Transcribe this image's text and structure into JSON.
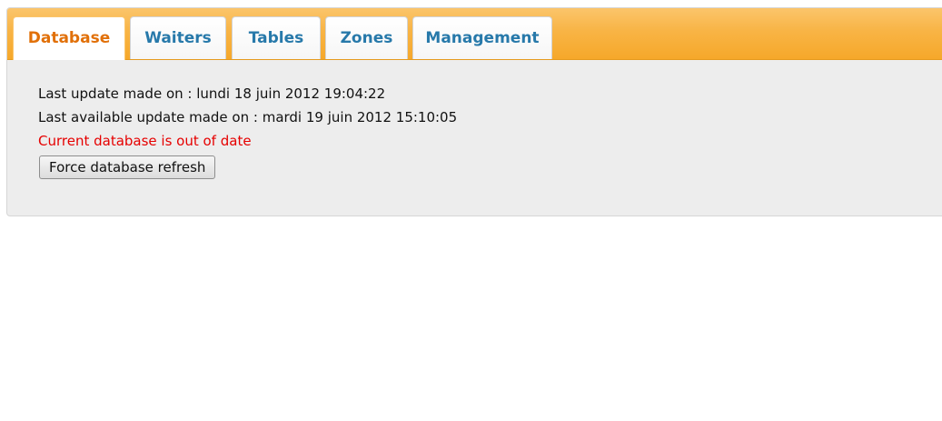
{
  "tabs": [
    {
      "label": "Database",
      "active": true
    },
    {
      "label": "Waiters",
      "active": false
    },
    {
      "label": "Tables",
      "active": false
    },
    {
      "label": "Zones",
      "active": false
    },
    {
      "label": "Management",
      "active": false
    }
  ],
  "panel": {
    "last_update": "Last update made on : lundi 18 juin 2012 19:04:22",
    "last_available_update": "Last available update made on : mardi 19 juin 2012 15:10:05",
    "status_message": "Current database is out of date",
    "refresh_button_label": "Force database refresh"
  },
  "colors": {
    "tab_bar_accent": "#f8b445",
    "active_tab_text": "#e17009",
    "inactive_tab_text": "#2779aa",
    "warning_text": "#e60000"
  }
}
